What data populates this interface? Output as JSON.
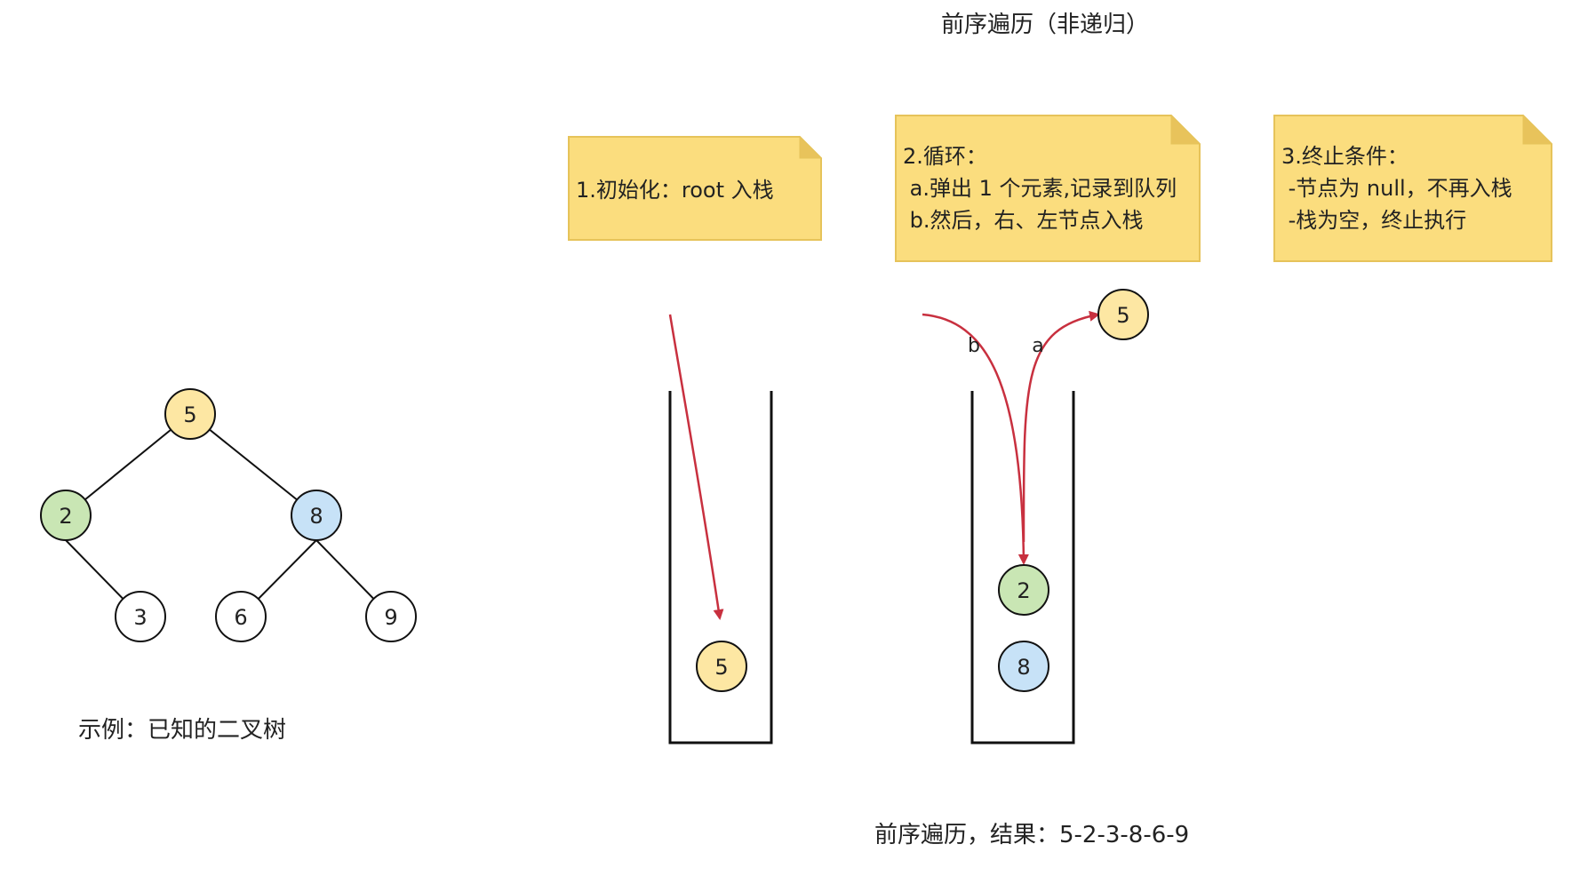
{
  "title": "前序遍历（非递归）",
  "tree_caption": "示例：已知的二叉树",
  "result_caption": "前序遍历，结果：5-2-3-8-6-9",
  "notes": {
    "init": "1.初始化：root 入栈",
    "loop_title": "2.循环：",
    "loop_a": " a.弹出 1 个元素,记录到队列",
    "loop_b": " b.然后，右、左节点入栈",
    "stop_title": "3.终止条件：",
    "stop_1": " -节点为 null，不再入栈",
    "stop_2": " -栈为空，终止执行"
  },
  "tree": {
    "root": "5",
    "left": "2",
    "right": "8",
    "left_right": "3",
    "right_left": "6",
    "right_right": "9"
  },
  "stack1": {
    "items": [
      "5"
    ]
  },
  "stack2": {
    "items": [
      "2",
      "8"
    ],
    "popped": "5",
    "arrow_a": "a",
    "arrow_b": "b"
  },
  "colors": {
    "yellow_node": "#fde7a3",
    "green_node": "#c9e6b4",
    "blue_node": "#c7e2f7",
    "white_node": "#ffffff",
    "note_fill": "#fbdd7e",
    "note_stroke": "#e6c35a",
    "arrow": "#c8303f"
  }
}
